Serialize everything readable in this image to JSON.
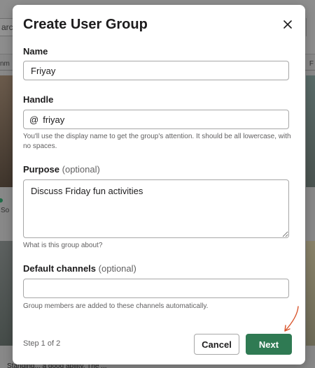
{
  "background": {
    "search_fragment": "arc",
    "left_fragment": "nm",
    "right_fragment": "F",
    "small_fragment": "So",
    "bottom_fragment": "Standing... a good ability. The ..."
  },
  "modal": {
    "title": "Create User Group",
    "close_icon": "close-icon",
    "name": {
      "label": "Name",
      "value": "Friyay"
    },
    "handle": {
      "label": "Handle",
      "prefix": "@",
      "value": "friyay",
      "help": "You'll use the display name to get the group's attention. It should be all lowercase, with no spaces."
    },
    "purpose": {
      "label": "Purpose",
      "optional": "(optional)",
      "value": "Discuss Friday fun activities",
      "help": "What is this group about?"
    },
    "channels": {
      "label": "Default channels",
      "optional": "(optional)",
      "value": "",
      "help": "Group members are added to these channels automatically."
    },
    "footer": {
      "step": "Step 1 of 2",
      "cancel_label": "Cancel",
      "next_label": "Next"
    }
  },
  "colors": {
    "primary_button": "#2f7a53",
    "annotation_arrow": "#d9542b"
  }
}
